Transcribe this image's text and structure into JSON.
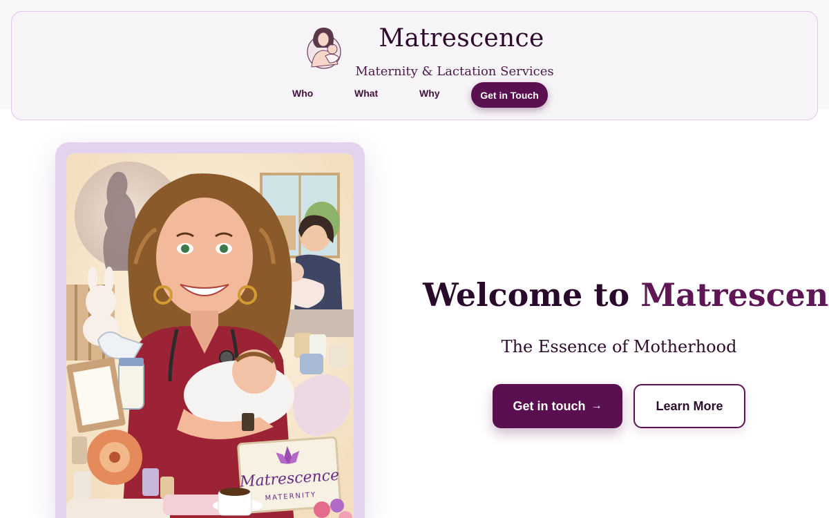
{
  "brand": {
    "title": "Matrescence",
    "subtitle": "Maternity & Lactation Services",
    "logo_icon": "mother-baby-icon"
  },
  "nav": {
    "items": [
      {
        "label": "Who"
      },
      {
        "label": "What"
      },
      {
        "label": "Why"
      }
    ],
    "cta_label": "Get in Touch"
  },
  "hero": {
    "title_prefix": "Welcome to",
    "title_accent": "Matrescence",
    "subtitle": "The Essence of Motherhood",
    "primary_button": "Get in touch",
    "primary_button_icon": "arrow-right-icon",
    "secondary_button": "Learn More"
  },
  "illustration": {
    "sign_text": "Matrescence",
    "sign_subtext": "MATERNITY"
  },
  "colors": {
    "primary": "#5a1050",
    "accent_text": "#5e1655",
    "frame": "#e4d3ef",
    "header_border": "#e3c6ee"
  }
}
